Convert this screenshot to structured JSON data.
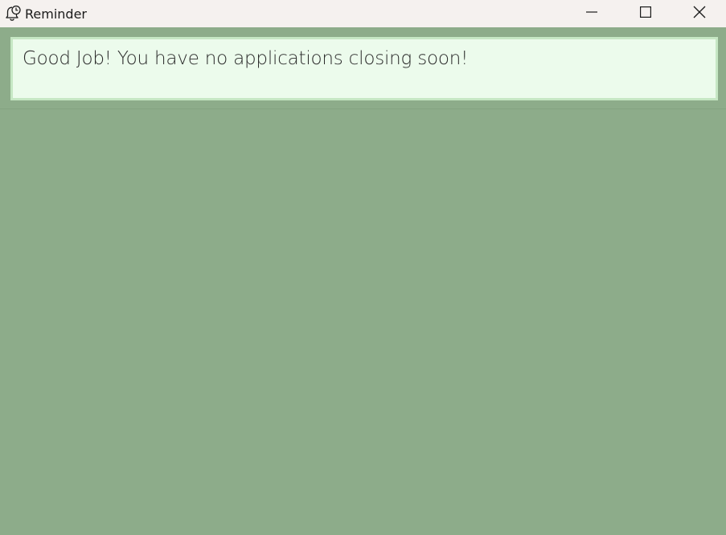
{
  "window": {
    "title": "Reminder",
    "app_icon": "bell-clock-icon",
    "controls": [
      "minimize-icon",
      "maximize-icon",
      "close-icon"
    ]
  },
  "reminder": {
    "message": "Good Job! You have no applications closing soon!"
  },
  "colors": {
    "background": "#8dac8a",
    "titlebar": "#f5f1ef",
    "message_bg": "#ecfbec",
    "message_border": "#c6e7c4"
  }
}
